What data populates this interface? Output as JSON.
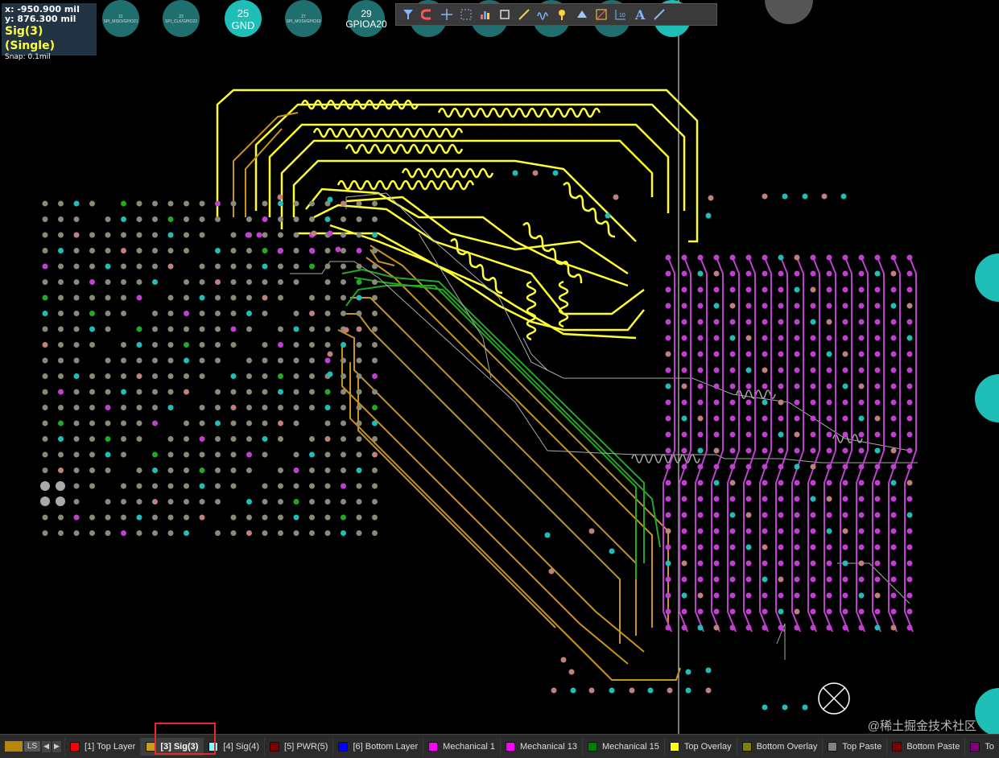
{
  "hud": {
    "x_label": "x:",
    "x_value": "-950.900 mil",
    "y_label": "y:",
    "y_value": "876.300 mil",
    "layer": "Sig(3) (Single)",
    "snap": "Snap: 0.1mil"
  },
  "pads": [
    {
      "number": "21",
      "net": "SPI_MISO/GPIO21"
    },
    {
      "number": "23",
      "net": "SPI_CLK/GPIO22"
    },
    {
      "number": "25",
      "net": "GND"
    },
    {
      "number": "27",
      "net": "SPI_MOSI/GPIO19"
    },
    {
      "number": "29",
      "net": "GPIOA20"
    }
  ],
  "toolbar": {
    "icons": [
      "filter-icon",
      "magnet-icon",
      "crosshair-icon",
      "select-rect-icon",
      "chart-icon",
      "component-icon",
      "route-icon",
      "interactive-length-icon",
      "pin-icon",
      "polygon-icon",
      "via-icon",
      "dimension-icon",
      "text-icon",
      "line-icon"
    ]
  },
  "layerbar": {
    "ls_label": "LS",
    "tabs": [
      {
        "label": "[1] Top Layer",
        "color": "#ff0000"
      },
      {
        "label": "[3] Sig(3)",
        "color": "#c8a015",
        "active": true
      },
      {
        "label": "[4] Sig(4)",
        "color": "#80ffff"
      },
      {
        "label": "[5] PWR(5)",
        "color": "#800000"
      },
      {
        "label": "[6] Bottom Layer",
        "color": "#0000ff"
      },
      {
        "label": "Mechanical 1",
        "color": "#ff00ff"
      },
      {
        "label": "Mechanical 13",
        "color": "#ff00ff"
      },
      {
        "label": "Mechanical 15",
        "color": "#008000"
      },
      {
        "label": "Top Overlay",
        "color": "#ffff00"
      },
      {
        "label": "Bottom Overlay",
        "color": "#808000"
      },
      {
        "label": "Top Paste",
        "color": "#808080"
      },
      {
        "label": "Bottom Paste",
        "color": "#800000"
      },
      {
        "label": "To",
        "color": "#800080"
      }
    ]
  },
  "watermark": "@稀土掘金技术社区",
  "colors": {
    "background": "#000000",
    "sig3": "#c8941c",
    "top_overlay": "#ffff33",
    "mech1": "#c040d0",
    "green": "#22aa22",
    "cyan_pad": "#1fbfb8"
  }
}
